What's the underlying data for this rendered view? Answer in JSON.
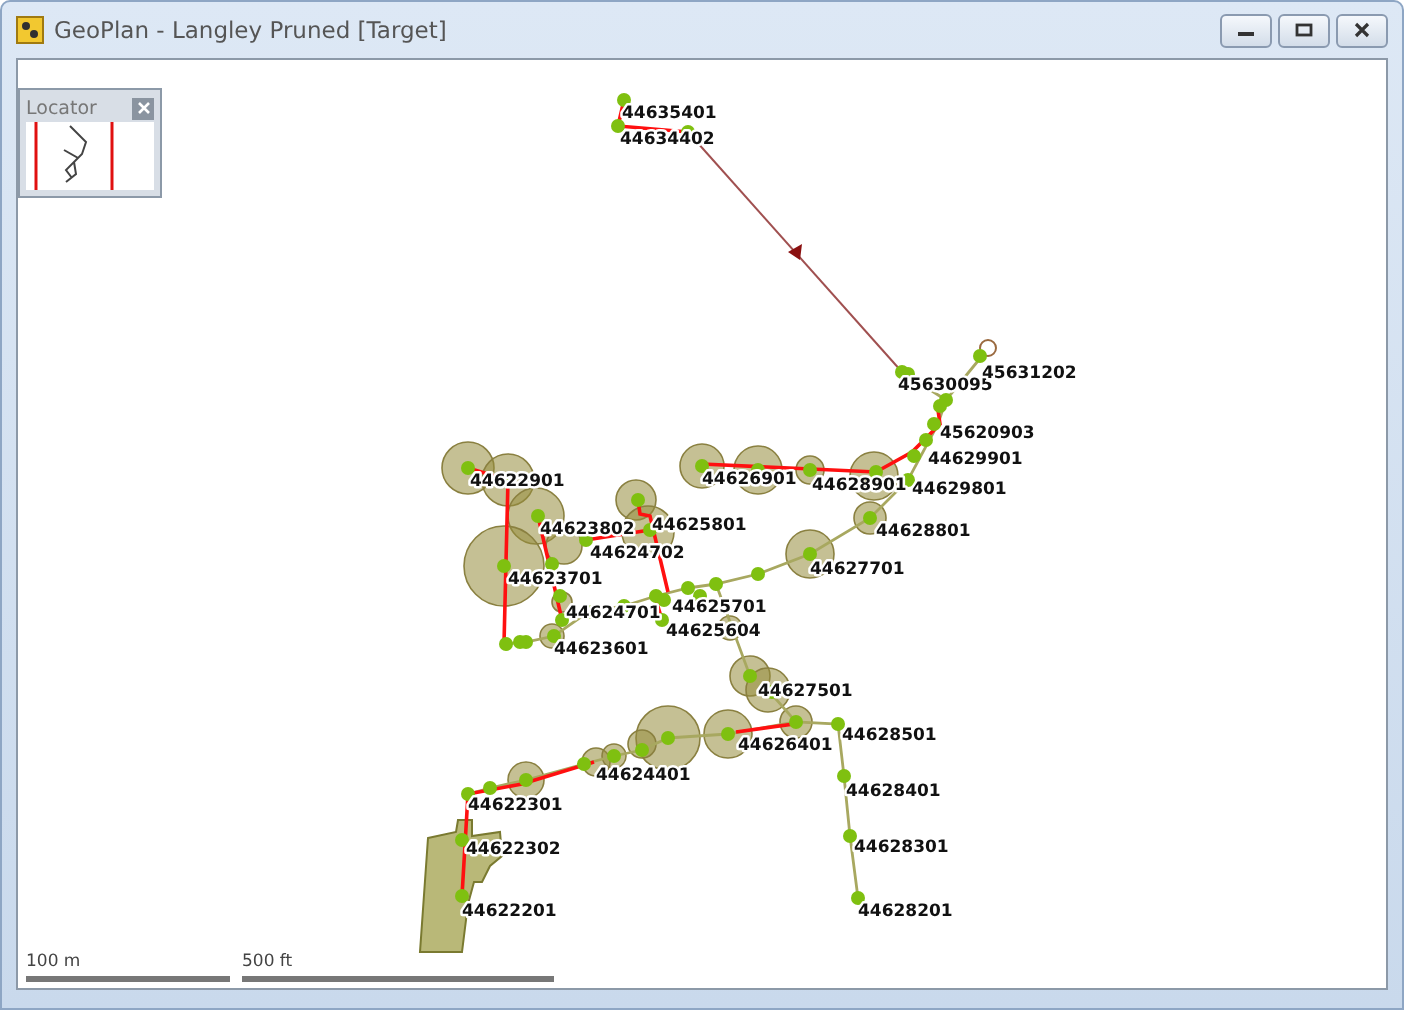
{
  "window": {
    "title": "GeoPlan - Langley Pruned [Target]"
  },
  "locator": {
    "title": "Locator"
  },
  "nodes": [
    {
      "label": "44635401"
    },
    {
      "label": "44634402"
    },
    {
      "label": "45630095"
    },
    {
      "label": "45631202"
    },
    {
      "label": "45620903"
    },
    {
      "label": "44629901"
    },
    {
      "label": "44629801"
    },
    {
      "label": "44628801"
    },
    {
      "label": "44627701"
    },
    {
      "label": "44622901"
    },
    {
      "label": "44626901"
    },
    {
      "label": "44628901"
    },
    {
      "label": "44623802"
    },
    {
      "label": "44625801"
    },
    {
      "label": "44624702"
    },
    {
      "label": "44623701"
    },
    {
      "label": "44624701"
    },
    {
      "label": "44625701"
    },
    {
      "label": "44625604"
    },
    {
      "label": "44623601"
    },
    {
      "label": "44627501"
    },
    {
      "label": "44628501"
    },
    {
      "label": "44626401"
    },
    {
      "label": "44624401"
    },
    {
      "label": "44628401"
    },
    {
      "label": "44622301"
    },
    {
      "label": "44622302"
    },
    {
      "label": "44628301"
    },
    {
      "label": "44622201"
    },
    {
      "label": "44628201"
    }
  ],
  "scale_bars": [
    {
      "label": "100 m"
    },
    {
      "label": "500 ft"
    }
  ]
}
